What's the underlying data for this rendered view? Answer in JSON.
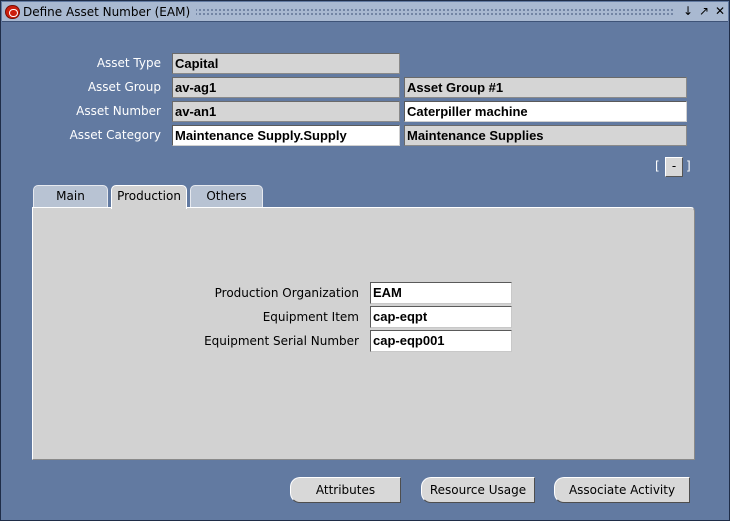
{
  "window": {
    "title": "Define Asset Number (EAM)",
    "controls": [
      "↓",
      "↗",
      "✕"
    ]
  },
  "header": {
    "rows": [
      {
        "label": "Asset Type",
        "value": "Capital",
        "desc": ""
      },
      {
        "label": "Asset Group",
        "value": "av-ag1",
        "desc": "Asset Group #1"
      },
      {
        "label": "Asset Number",
        "value": "av-an1",
        "desc": "Caterpiller machine"
      },
      {
        "label": "Asset Category",
        "value": "Maintenance Supply.Supply",
        "desc": "Maintenance Supplies"
      }
    ],
    "bracket_left": "[",
    "bracket_right": "]",
    "mini_button": "-"
  },
  "tabs": [
    {
      "label": "Main"
    },
    {
      "label": "Production"
    },
    {
      "label": "Others"
    }
  ],
  "active_tab": "Production",
  "production": {
    "fields": [
      {
        "label": "Production Organization",
        "value": "EAM"
      },
      {
        "label": "Equipment Item",
        "value": "cap-eqpt"
      },
      {
        "label": "Equipment Serial Number",
        "value": "cap-eqp001"
      }
    ]
  },
  "buttons": {
    "attributes": "Attributes",
    "resource_usage": "Resource Usage",
    "associate_activity": "Associate Activity"
  },
  "colors": {
    "background": "#627aa1",
    "panel": "#d2d2d2",
    "title_bar": "#a9b9d1"
  }
}
